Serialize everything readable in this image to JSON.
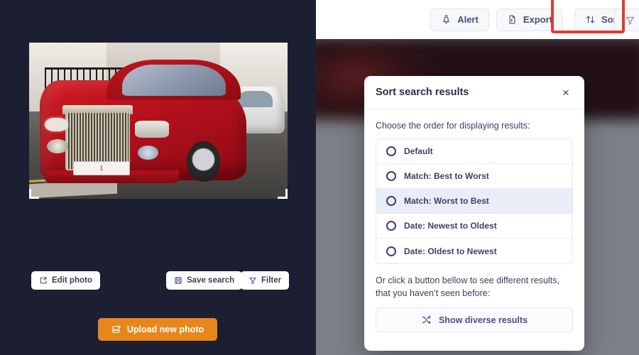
{
  "left_panel": {
    "photo": {
      "alt": "red Rolls-Royce Phantom parked on a city street",
      "plate_text": "1",
      "crop_handles": [
        "bottom-left",
        "bottom-right"
      ]
    },
    "buttons": {
      "edit_photo": "Edit photo",
      "save_search": "Save search",
      "filter": "Filter",
      "upload": "Upload new photo"
    },
    "colors": {
      "panel_bg": "#1b1f31",
      "upload_bg": "#e8861e",
      "button_text": "#3c3f52"
    }
  },
  "toolbar": {
    "buttons": [
      {
        "label": "Alert",
        "icon": "bell-icon"
      },
      {
        "label": "Export",
        "icon": "file-export-icon"
      },
      {
        "label": "Sort",
        "icon": "sort-arrows-icon"
      },
      {
        "label": "",
        "icon": "filter-funnel-icon"
      }
    ],
    "highlight_color": "#e23b30",
    "highlighted_button": "Sort"
  },
  "modal": {
    "title": "Sort search results",
    "close_label": "×",
    "prompt": "Choose the order for displaying results:",
    "options": [
      {
        "label": "Default",
        "selected": false
      },
      {
        "label": "Match: Best to Worst",
        "selected": false
      },
      {
        "label": "Match: Worst to Best",
        "selected": true
      },
      {
        "label": "Date: Newest to Oldest",
        "selected": false
      },
      {
        "label": "Date: Oldest to Newest",
        "selected": false
      }
    ],
    "note": "Or click a button bellow to see different results, that you haven’t seen before:",
    "diverse_button": "Show diverse results",
    "highlight_bg": "#e8edf7"
  }
}
